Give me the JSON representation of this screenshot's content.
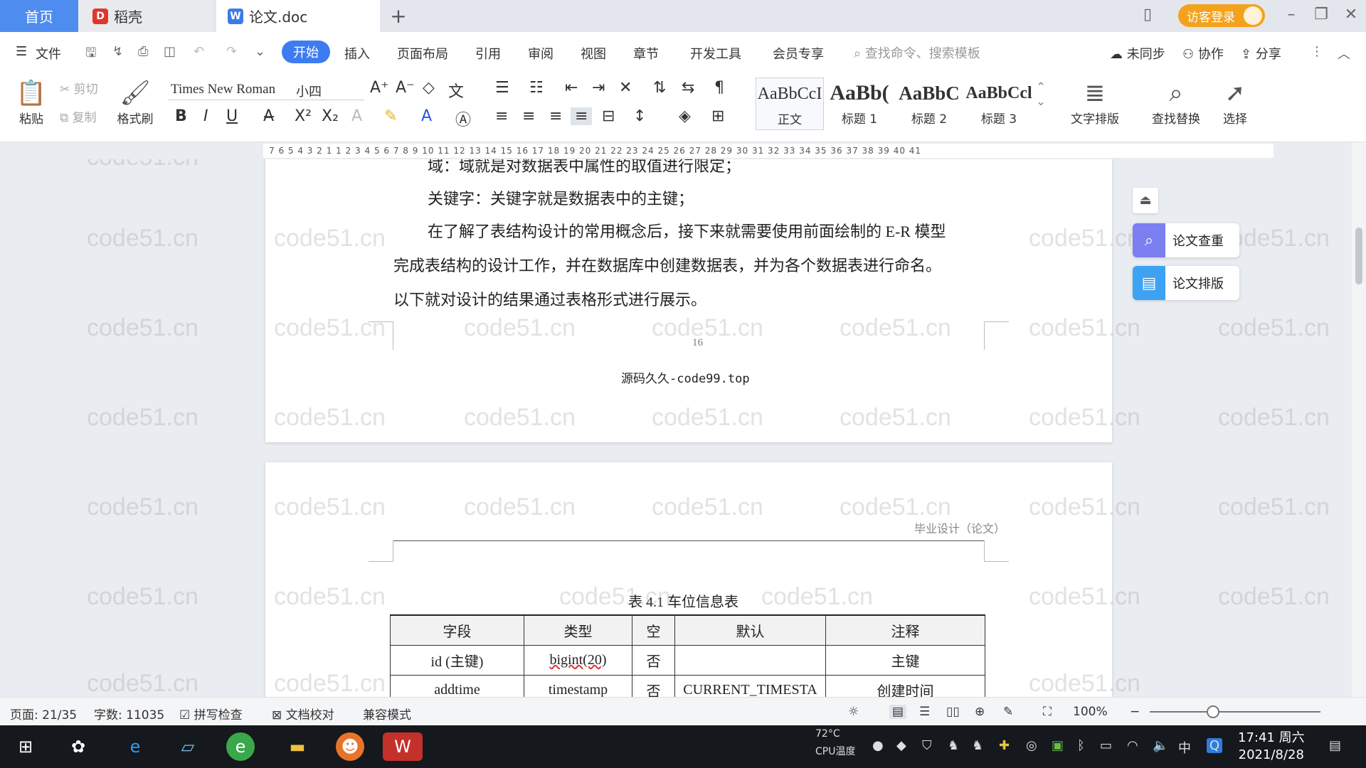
{
  "tabs": {
    "home": "首页",
    "daoke": "稻壳",
    "doc": "论文.doc",
    "new_tab": "+"
  },
  "account": {
    "visitor_login": "访客登录"
  },
  "menu": {
    "file": "文件",
    "items": [
      "开始",
      "插入",
      "页面布局",
      "引用",
      "审阅",
      "视图",
      "章节",
      "开发工具",
      "会员专享"
    ],
    "search_placeholder": "查找命令、搜索模板",
    "right": {
      "sync": "未同步",
      "collab": "协作",
      "share": "分享"
    }
  },
  "ribbon": {
    "paste": "粘贴",
    "cut": "剪切",
    "copy": "复制",
    "format_painter": "格式刷",
    "font_name": "Times New Roman",
    "font_size": "小四",
    "styles": [
      {
        "sample": "AaBbCcI",
        "label": "正文"
      },
      {
        "sample": "AaBb(",
        "label": "标题 1"
      },
      {
        "sample": "AaBbC",
        "label": "标题 2"
      },
      {
        "sample": "AaBbCcl",
        "label": "标题 3"
      }
    ],
    "text_layout": "文字排版",
    "find_replace": "查找替换",
    "select": "选择"
  },
  "ruler": {
    "scale": "7 6 5 4 3 2 1 1 2 3 4 5 6 7 8 9 10 11 12 13 14 15 16 17 18 19 20 21 22 23 24 25 26 27 28 29 30 31 32 33 34 35 36 37 38 39 40 41"
  },
  "page1": {
    "line0": "域：域就是对数据表中属性的取值进行限定；",
    "line1": "关键字：关键字就是数据表中的主键；",
    "line2": "在了解了表结构设计的常用概念后，接下来就需要使用前面绘制的 E-R 模型",
    "line3": "完成表结构的设计工作，并在数据库中创建数据表，并为各个数据表进行命名。",
    "line4": "以下就对设计的结果通过表格形式进行展示。",
    "page_number": "16",
    "footer": "源码久久-code99.top"
  },
  "page2": {
    "header": "毕业设计（论文）",
    "caption": "表 4.1  车位信息表",
    "table": {
      "headers": [
        "字段",
        "类型",
        "空",
        "默认",
        "注释"
      ],
      "rows": [
        [
          "id (主键)",
          "bigint(20)",
          "否",
          "",
          "主键"
        ],
        [
          "addtime",
          "timestamp",
          "否",
          "CURRENT_TIMESTA",
          "创建时间"
        ]
      ]
    }
  },
  "side_panel": {
    "check": "论文查重",
    "layout": "论文排版"
  },
  "watermark": "code51.cn",
  "status": {
    "page": "页面: 21/35",
    "words": "字数: 11035",
    "spell": "拼写检查",
    "proof": "文档校对",
    "compat": "兼容模式",
    "zoom": "100%",
    "zoom_fraction": 0.37
  },
  "taskbar": {
    "temp": "72°C",
    "cpu": "CPU温度",
    "ime": "中",
    "time": "17:41 周六",
    "date": "2021/8/28"
  }
}
